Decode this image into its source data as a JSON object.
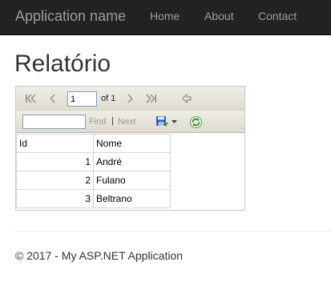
{
  "navbar": {
    "brand": "Application name",
    "links": [
      "Home",
      "About",
      "Contact"
    ]
  },
  "page": {
    "title": "Relatório"
  },
  "viewer": {
    "page_current": "1",
    "page_of": "of 1",
    "find_label": "Find",
    "separator": "|",
    "next_label": "Next",
    "icons": [
      "first-page-icon",
      "previous-page-icon",
      "next-page-icon",
      "last-page-icon",
      "back-icon",
      "export-icon",
      "dropdown-arrow-icon",
      "refresh-icon"
    ],
    "table": {
      "headers": [
        "Id",
        "Nome"
      ],
      "rows": [
        [
          "1",
          "André"
        ],
        [
          "2",
          "Fulano"
        ],
        [
          "3",
          "Beltrano"
        ]
      ]
    }
  },
  "footer": {
    "text": "© 2017 - My ASP.NET Application"
  },
  "colors": {
    "navbar_bg": "#222222",
    "nav_text": "#9d9d9d",
    "toolbar_bg": "#e6e4da",
    "link_disabled": "#999999"
  }
}
